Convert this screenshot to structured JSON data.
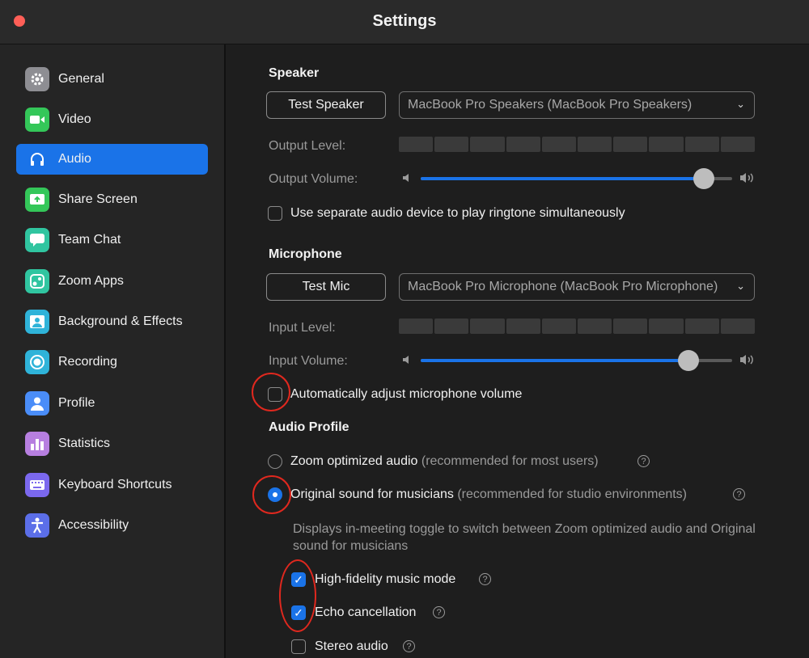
{
  "window": {
    "title": "Settings"
  },
  "sidebar": {
    "items": [
      {
        "label": "General",
        "icon": "gear-icon",
        "color": "#8e8e93",
        "active": false
      },
      {
        "label": "Video",
        "icon": "video-camera-icon",
        "color": "#34c759",
        "active": false
      },
      {
        "label": "Audio",
        "icon": "headphones-icon",
        "color": "#1a73e8",
        "active": true
      },
      {
        "label": "Share Screen",
        "icon": "share-screen-icon",
        "color": "#34c759",
        "active": false
      },
      {
        "label": "Team Chat",
        "icon": "chat-bubble-icon",
        "color": "#30c5a0",
        "active": false
      },
      {
        "label": "Zoom Apps",
        "icon": "apps-icon",
        "color": "#30c5a0",
        "active": false
      },
      {
        "label": "Background & Effects",
        "icon": "background-icon",
        "color": "#2fb3d9",
        "active": false
      },
      {
        "label": "Recording",
        "icon": "record-icon",
        "color": "#2fb3d9",
        "active": false
      },
      {
        "label": "Profile",
        "icon": "profile-icon",
        "color": "#4a8df8",
        "active": false
      },
      {
        "label": "Statistics",
        "icon": "statistics-icon",
        "color": "#b77fe0",
        "active": false
      },
      {
        "label": "Keyboard Shortcuts",
        "icon": "keyboard-icon",
        "color": "#7b68ee",
        "active": false
      },
      {
        "label": "Accessibility",
        "icon": "accessibility-icon",
        "color": "#5b6ee8",
        "active": false
      }
    ]
  },
  "speaker": {
    "title": "Speaker",
    "test_button": "Test Speaker",
    "device": "MacBook Pro Speakers (MacBook Pro Speakers)",
    "output_level_label": "Output Level:",
    "output_volume_label": "Output Volume:",
    "output_volume": 0.91,
    "ringtone_option": "Use separate audio device to play ringtone simultaneously",
    "ringtone_checked": false
  },
  "microphone": {
    "title": "Microphone",
    "test_button": "Test Mic",
    "device": "MacBook Pro Microphone (MacBook Pro Microphone)",
    "input_level_label": "Input Level:",
    "input_volume_label": "Input Volume:",
    "input_volume": 0.86,
    "auto_adjust_label": "Automatically adjust microphone volume",
    "auto_adjust_checked": false
  },
  "audio_profile": {
    "title": "Audio Profile",
    "zoom_optimized": {
      "label": "Zoom optimized audio",
      "note": "(recommended for most users)",
      "selected": false
    },
    "original_sound": {
      "label": "Original sound for musicians",
      "note": "(recommended for studio environments)",
      "selected": true
    },
    "description": "Displays in-meeting toggle to switch between Zoom optimized audio and Original sound for musicians",
    "high_fidelity": {
      "label": "High-fidelity music mode",
      "checked": true
    },
    "echo_cancellation": {
      "label": "Echo cancellation",
      "checked": true
    },
    "stereo_audio": {
      "label": "Stereo audio",
      "checked": false
    }
  },
  "glyphs": {
    "chevron": "⌄",
    "check": "✓",
    "help": "?"
  },
  "colors": {
    "accent": "#1a73e8",
    "annotation": "#e0281e"
  }
}
